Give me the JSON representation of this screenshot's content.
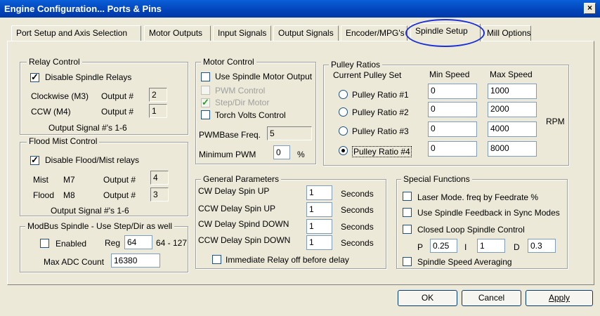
{
  "window": {
    "title": "Engine Configuration... Ports & Pins",
    "close_glyph": "×"
  },
  "tabs": [
    {
      "label": "Port Setup and Axis Selection"
    },
    {
      "label": "Motor Outputs"
    },
    {
      "label": "Input Signals"
    },
    {
      "label": "Output Signals"
    },
    {
      "label": "Encoder/MPG's"
    },
    {
      "label": "Spindle Setup",
      "active": true
    },
    {
      "label": "Mill Options"
    }
  ],
  "relay_control": {
    "title": "Relay Control",
    "disable_label": "Disable Spindle Relays",
    "disable_checked": true,
    "cw_label": "Clockwise (M3)",
    "cw_output_label": "Output #",
    "cw_output_value": "2",
    "ccw_label": "CCW (M4)",
    "ccw_output_label": "Output #",
    "ccw_output_value": "1",
    "note": "Output Signal #'s 1-6"
  },
  "flood_mist": {
    "title": "Flood Mist Control",
    "disable_label": "Disable Flood/Mist relays",
    "disable_checked": true,
    "mist_label": "Mist",
    "mist_code": "M7",
    "mist_output_label": "Output #",
    "mist_output_value": "4",
    "flood_label": "Flood",
    "flood_code": "M8",
    "flood_output_label": "Output #",
    "flood_output_value": "3",
    "note": "Output Signal #'s 1-6"
  },
  "modbus": {
    "title": "ModBus Spindle - Use Step/Dir as well",
    "enabled_label": "Enabled",
    "enabled_checked": false,
    "reg_label": "Reg",
    "reg_value": "64",
    "reg_range": "64 - 127",
    "max_adc_label": "Max ADC Count",
    "max_adc_value": "16380"
  },
  "motor_control": {
    "title": "Motor Control",
    "use_spindle_motor_label": "Use Spindle Motor Output",
    "pwm_control_label": "PWM Control",
    "step_dir_label": "Step/Dir Motor",
    "torch_volts_label": "Torch Volts Control",
    "pwmbase_label": "PWMBase Freq.",
    "pwmbase_value": "5",
    "min_pwm_label": "Minimum PWM",
    "min_pwm_value": "0",
    "min_pwm_unit": "%"
  },
  "pulley_ratios": {
    "title": "Pulley Ratios",
    "current_label": "Current Pulley Set",
    "min_header": "Min Speed",
    "max_header": "Max Speed",
    "unit": "RPM",
    "rows": [
      {
        "label": "Pulley Ratio #1",
        "min": "0",
        "max": "1000",
        "selected": false
      },
      {
        "label": "Pulley Ratio #2",
        "min": "0",
        "max": "2000",
        "selected": false
      },
      {
        "label": "Pulley Ratio #3",
        "min": "0",
        "max": "4000",
        "selected": false
      },
      {
        "label": "Pulley Ratio #4",
        "min": "0",
        "max": "8000",
        "selected": true
      }
    ]
  },
  "general_params": {
    "title": "General Parameters",
    "rows": [
      {
        "label": "CW Delay Spin UP",
        "value": "1",
        "unit": "Seconds"
      },
      {
        "label": "CCW Delay Spin UP",
        "value": "1",
        "unit": "Seconds"
      },
      {
        "label": "CW Delay Spind DOWN",
        "value": "1",
        "unit": "Seconds"
      },
      {
        "label": "CCW Delay Spin DOWN",
        "value": "1",
        "unit": "Seconds"
      }
    ],
    "immediate_relay_label": "Immediate Relay off before delay"
  },
  "special_functions": {
    "title": "Special Functions",
    "laser_label": "Laser Mode. freq by Feedrate %",
    "spindle_feedback_label": "Use Spindle Feedback in Sync Modes",
    "closed_loop_label": "Closed Loop Spindle Control",
    "p_label": "P",
    "p_value": "0.25",
    "i_label": "I",
    "i_value": "1",
    "d_label": "D",
    "d_value": "0.3",
    "averaging_label": "Spindle Speed Averaging"
  },
  "buttons": {
    "ok": "OK",
    "cancel": "Cancel",
    "apply": "Apply"
  }
}
